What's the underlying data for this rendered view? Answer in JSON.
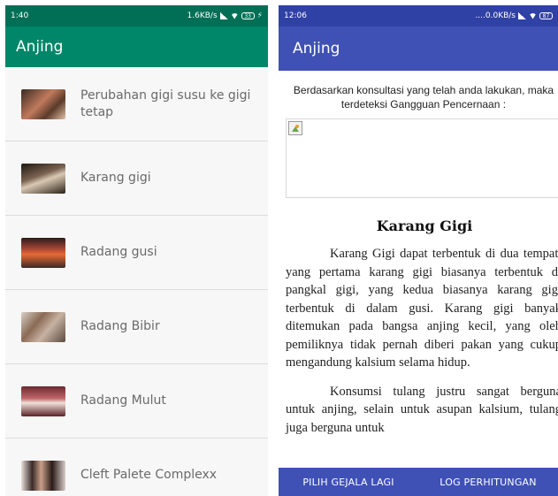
{
  "left_screen": {
    "status_bar": {
      "time": "1:40",
      "network_speed": "1.6KB/s",
      "battery": "33"
    },
    "app_title": "Anjing",
    "list_items": [
      {
        "label": "Perubahan gigi susu ke gigi tetap"
      },
      {
        "label": "Karang gigi"
      },
      {
        "label": "Radang gusi"
      },
      {
        "label": "Radang Bibir"
      },
      {
        "label": "Radang Mulut"
      },
      {
        "label": "Cleft Palete Complexx"
      }
    ]
  },
  "right_screen": {
    "status_bar": {
      "time": "12:06",
      "network_speed": "....0.0KB/s",
      "battery": "87"
    },
    "app_title": "Anjing",
    "intro_text": "Berdasarkan konsultasi yang telah anda lakukan, maka terdeteksi Gangguan Pencernaan :",
    "article_title": "Karang Gigi",
    "paragraphs": [
      "Karang Gigi dapat terbentuk di dua tempat, yang pertama karang gigi biasanya terbentuk di pangkal gigi, yang kedua biasanya karang gigi terbentuk di dalam gusi. Karang gigi banyak ditemukan pada bangsa anjing kecil, yang oleh pemiliknya tidak pernah diberi pakan yang cukup mengandung kalsium selama hidup.",
      "Konsumsi tulang justru sangat berguna untuk anjing, selain untuk asupan kalsium, tulang juga berguna untuk"
    ],
    "buttons": {
      "select_again": "PILIH GEJALA LAGI",
      "log": "LOG PERHITUNGAN"
    }
  }
}
